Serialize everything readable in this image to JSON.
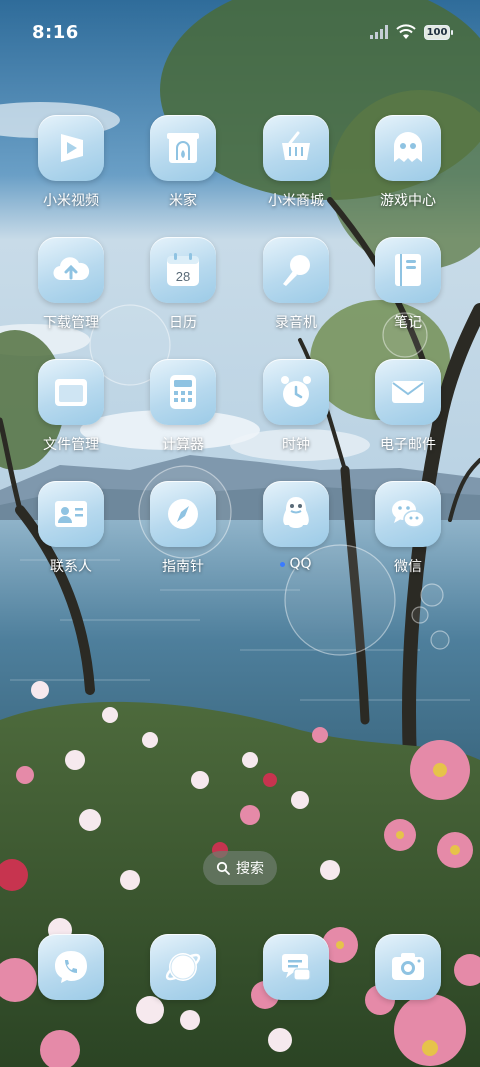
{
  "status_bar": {
    "time": "8:16",
    "battery": "100"
  },
  "apps": [
    {
      "label": "小米视频",
      "icon": "video-icon"
    },
    {
      "label": "米家",
      "icon": "home-icon"
    },
    {
      "label": "小米商城",
      "icon": "shopping-basket-icon"
    },
    {
      "label": "游戏中心",
      "icon": "ghost-icon"
    },
    {
      "label": "下载管理",
      "icon": "cloud-upload-icon"
    },
    {
      "label": "日历",
      "icon": "calendar-icon",
      "date": "28"
    },
    {
      "label": "录音机",
      "icon": "microphone-icon"
    },
    {
      "label": "笔记",
      "icon": "notebook-icon"
    },
    {
      "label": "文件管理",
      "icon": "folder-icon"
    },
    {
      "label": "计算器",
      "icon": "calculator-icon"
    },
    {
      "label": "时钟",
      "icon": "alarm-clock-icon"
    },
    {
      "label": "电子邮件",
      "icon": "mail-icon"
    },
    {
      "label": "联系人",
      "icon": "contact-card-icon"
    },
    {
      "label": "指南针",
      "icon": "compass-icon"
    },
    {
      "label": "QQ",
      "icon": "penguin-icon"
    },
    {
      "label": "微信",
      "icon": "wechat-icon"
    }
  ],
  "search": {
    "label": "搜索"
  },
  "dock": [
    {
      "icon": "phone-icon"
    },
    {
      "icon": "browser-icon"
    },
    {
      "icon": "messages-icon"
    },
    {
      "icon": "camera-icon"
    }
  ],
  "colors": {
    "icon_light": "#e6f3fb",
    "icon_dark": "#9ccbe7",
    "label": "#ffffff"
  }
}
